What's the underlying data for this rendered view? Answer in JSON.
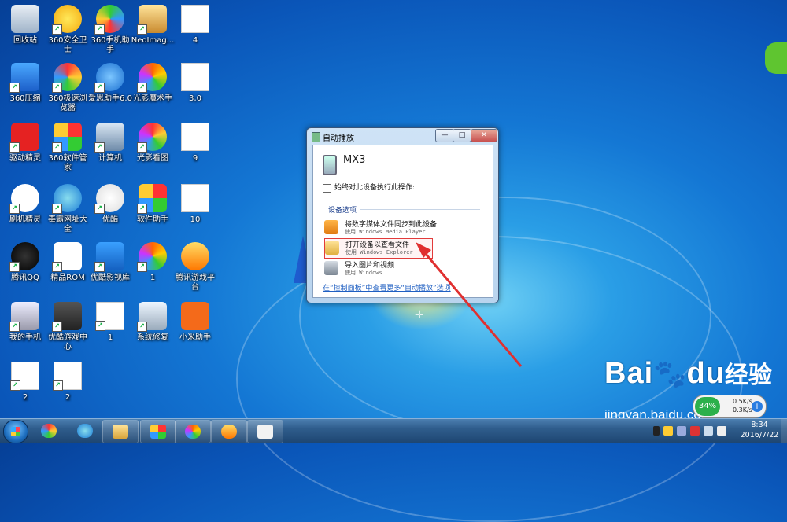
{
  "desktop": {
    "icons": [
      {
        "label": "回收站",
        "icon": "recycle-bin-icon"
      },
      {
        "label": "360安全卫士",
        "icon": "360-safe-icon"
      },
      {
        "label": "360手机助手",
        "icon": "360-phone-assistant-icon"
      },
      {
        "label": "NeoImag...",
        "icon": "neoimaging-icon"
      },
      {
        "label": "4",
        "icon": "image-file-icon"
      },
      {
        "label": "360压缩",
        "icon": "360-zip-icon"
      },
      {
        "label": "360极速浏览器",
        "icon": "360-browser-icon"
      },
      {
        "label": "爱思助手6.0",
        "icon": "i4-assistant-icon"
      },
      {
        "label": "光影魔术手",
        "icon": "nevercenter-icon"
      },
      {
        "label": "3,0",
        "icon": "image-file-icon"
      },
      {
        "label": "驱动精灵",
        "icon": "driver-genius-icon"
      },
      {
        "label": "360软件管家",
        "icon": "360-software-manager-icon"
      },
      {
        "label": "计算机",
        "icon": "computer-icon"
      },
      {
        "label": "光影看图",
        "icon": "photo-viewer-icon"
      },
      {
        "label": "9",
        "icon": "image-file-icon"
      },
      {
        "label": "刷机精灵",
        "icon": "flash-genius-icon"
      },
      {
        "label": "毒霸网址大全",
        "icon": "duba-browser-icon"
      },
      {
        "label": "优酷",
        "icon": "youku-icon"
      },
      {
        "label": "软件助手",
        "icon": "software-assistant-icon"
      },
      {
        "label": "10",
        "icon": "image-file-icon"
      },
      {
        "label": "腾讯QQ",
        "icon": "qq-icon"
      },
      {
        "label": "精品ROM",
        "icon": "rom-icon"
      },
      {
        "label": "优酷影视库",
        "icon": "youku-library-icon"
      },
      {
        "label": "1",
        "icon": "pinwheel-icon"
      },
      {
        "label": "腾讯游戏平台",
        "icon": "tencent-games-icon"
      },
      {
        "label": "我的手机",
        "icon": "my-phone-icon"
      },
      {
        "label": "优酷游戏中心",
        "icon": "youku-games-icon"
      },
      {
        "label": "1",
        "icon": "image-file-icon"
      },
      {
        "label": "系统修复",
        "icon": "system-repair-icon"
      },
      {
        "label": "小米助手",
        "icon": "mi-assistant-icon"
      },
      {
        "label": "2",
        "icon": "image-file-icon"
      },
      {
        "label": "2",
        "icon": "image-file-icon"
      }
    ]
  },
  "dialog": {
    "title": "自动播放",
    "minimize": "—",
    "maximize": "□",
    "close": "✕",
    "device_name": "MX3",
    "always_checkbox_label": "始终对此设备执行此操作:",
    "section_label": "设备选项",
    "options": [
      {
        "title": "将数字媒体文件同步到此设备",
        "subtitle": "使用 Windows Media Player"
      },
      {
        "title": "打开设备以查看文件",
        "subtitle": "使用 Windows Explorer"
      },
      {
        "title": "导入图片和视频",
        "subtitle": "使用 Windows"
      }
    ],
    "control_panel_link": "在“控制面板”中查看更多“自动播放”选项"
  },
  "watermark": {
    "main": "Bai",
    "main2": "du",
    "cn": "经验",
    "sub": "jingyan.baidu.com"
  },
  "network_widget": {
    "percent": "34%",
    "up": "0.5K/s",
    "down": "0.3K/s",
    "plus": "+"
  },
  "taskbar": {
    "clock_time": "8:34",
    "clock_date": "2016/7/22"
  }
}
